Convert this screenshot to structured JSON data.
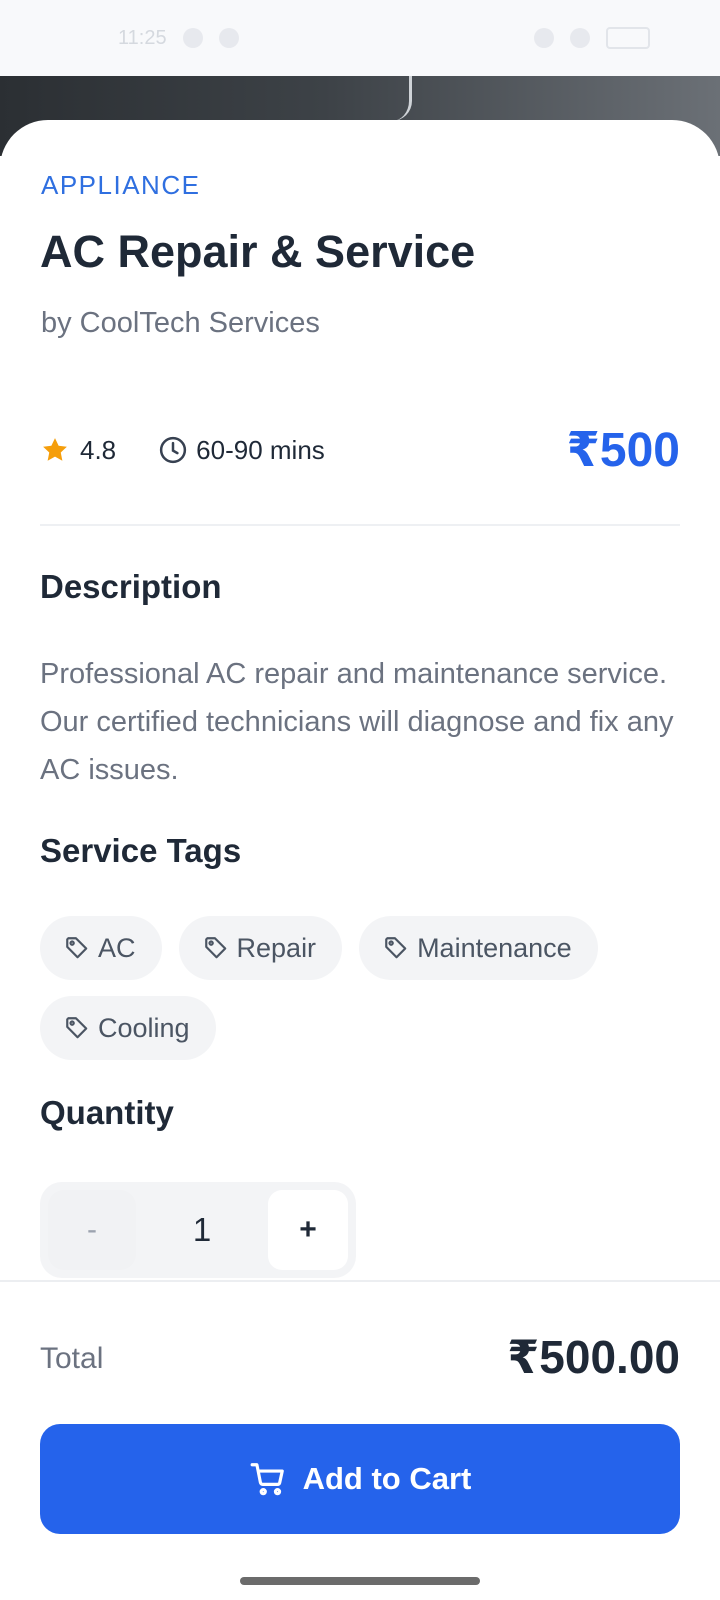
{
  "status_bar": {
    "time": "11:25"
  },
  "service": {
    "category": "APPLIANCE",
    "title": "AC Repair & Service",
    "provider": "by CoolTech Services",
    "rating": "4.8",
    "duration": "60-90 mins",
    "price": "₹500"
  },
  "description": {
    "heading": "Description",
    "text": "Professional AC repair and maintenance service. Our certified technicians will diagnose and fix any AC issues."
  },
  "tags": {
    "heading": "Service Tags",
    "items": [
      "AC",
      "Repair",
      "Maintenance",
      "Cooling"
    ]
  },
  "quantity": {
    "heading": "Quantity",
    "minus_label": "-",
    "value": "1",
    "plus_label": "+"
  },
  "footer": {
    "total_label": "Total",
    "total_value": "₹500.00",
    "add_to_cart_label": "Add to Cart"
  },
  "colors": {
    "accent": "#2563eb",
    "rating_star": "#f59e0b"
  },
  "icons": [
    "star-icon",
    "clock-icon",
    "tag-icon",
    "cart-icon"
  ]
}
